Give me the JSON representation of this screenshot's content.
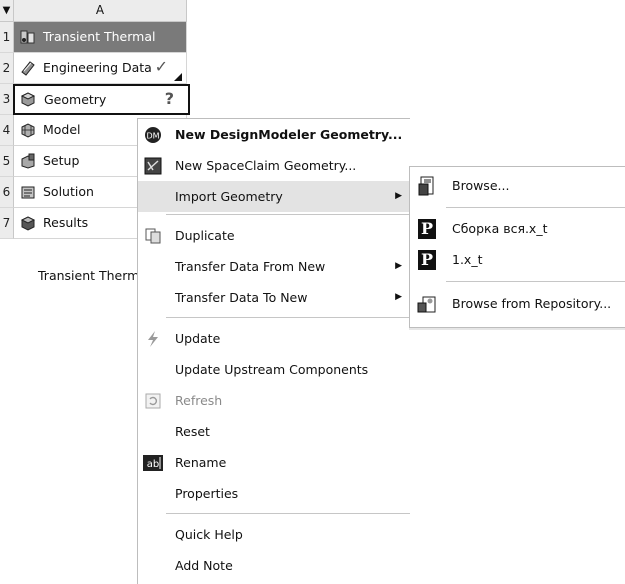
{
  "system": {
    "column_header": "A",
    "header_arrow": "▼",
    "rows": [
      {
        "index": "1",
        "label": "Transient Thermal",
        "icon": "transient-thermal-icon",
        "status": ""
      },
      {
        "index": "2",
        "label": "Engineering Data",
        "icon": "engineering-data-icon",
        "status": "✓"
      },
      {
        "index": "3",
        "label": "Geometry",
        "icon": "geometry-icon",
        "status": "?"
      },
      {
        "index": "4",
        "label": "Model",
        "icon": "model-icon",
        "status": ""
      },
      {
        "index": "5",
        "label": "Setup",
        "icon": "setup-icon",
        "status": ""
      },
      {
        "index": "6",
        "label": "Solution",
        "icon": "solution-icon",
        "status": ""
      },
      {
        "index": "7",
        "label": "Results",
        "icon": "results-icon",
        "status": ""
      }
    ],
    "caption": "Transient Therm"
  },
  "context_menu": {
    "items": [
      {
        "label": "New DesignModeler Geometry...",
        "icon": "designmodeler-icon"
      },
      {
        "label": "New SpaceClaim Geometry...",
        "icon": "spaceclaim-icon"
      },
      {
        "label": "Import Geometry",
        "icon": "",
        "submenu_arrow": "▶"
      },
      {
        "label": "Duplicate",
        "icon": "duplicate-icon"
      },
      {
        "label": "Transfer Data From New",
        "icon": "",
        "submenu_arrow": "▶"
      },
      {
        "label": "Transfer Data To New",
        "icon": "",
        "submenu_arrow": "▶"
      },
      {
        "label": "Update",
        "icon": "update-lightning-icon"
      },
      {
        "label": "Update Upstream Components",
        "icon": ""
      },
      {
        "label": "Refresh",
        "icon": "refresh-icon"
      },
      {
        "label": "Reset",
        "icon": ""
      },
      {
        "label": "Rename",
        "icon": "rename-icon"
      },
      {
        "label": "Properties",
        "icon": ""
      },
      {
        "label": "Quick Help",
        "icon": ""
      },
      {
        "label": "Add Note",
        "icon": ""
      }
    ]
  },
  "import_submenu": {
    "items": [
      {
        "label": "Browse...",
        "icon": "browse-icon"
      },
      {
        "label": "Сборка вся.x_t",
        "icon": "parasolid-file-icon",
        "badge": "P"
      },
      {
        "label": "1.x_t",
        "icon": "parasolid-file-icon",
        "badge": "P"
      },
      {
        "label": "Browse from Repository...",
        "icon": "repository-icon"
      }
    ]
  },
  "colors": {
    "title_row_bg": "#7a7a7a",
    "highlight_bg": "#e3e3e3",
    "disabled_text": "#8a8a8a"
  }
}
